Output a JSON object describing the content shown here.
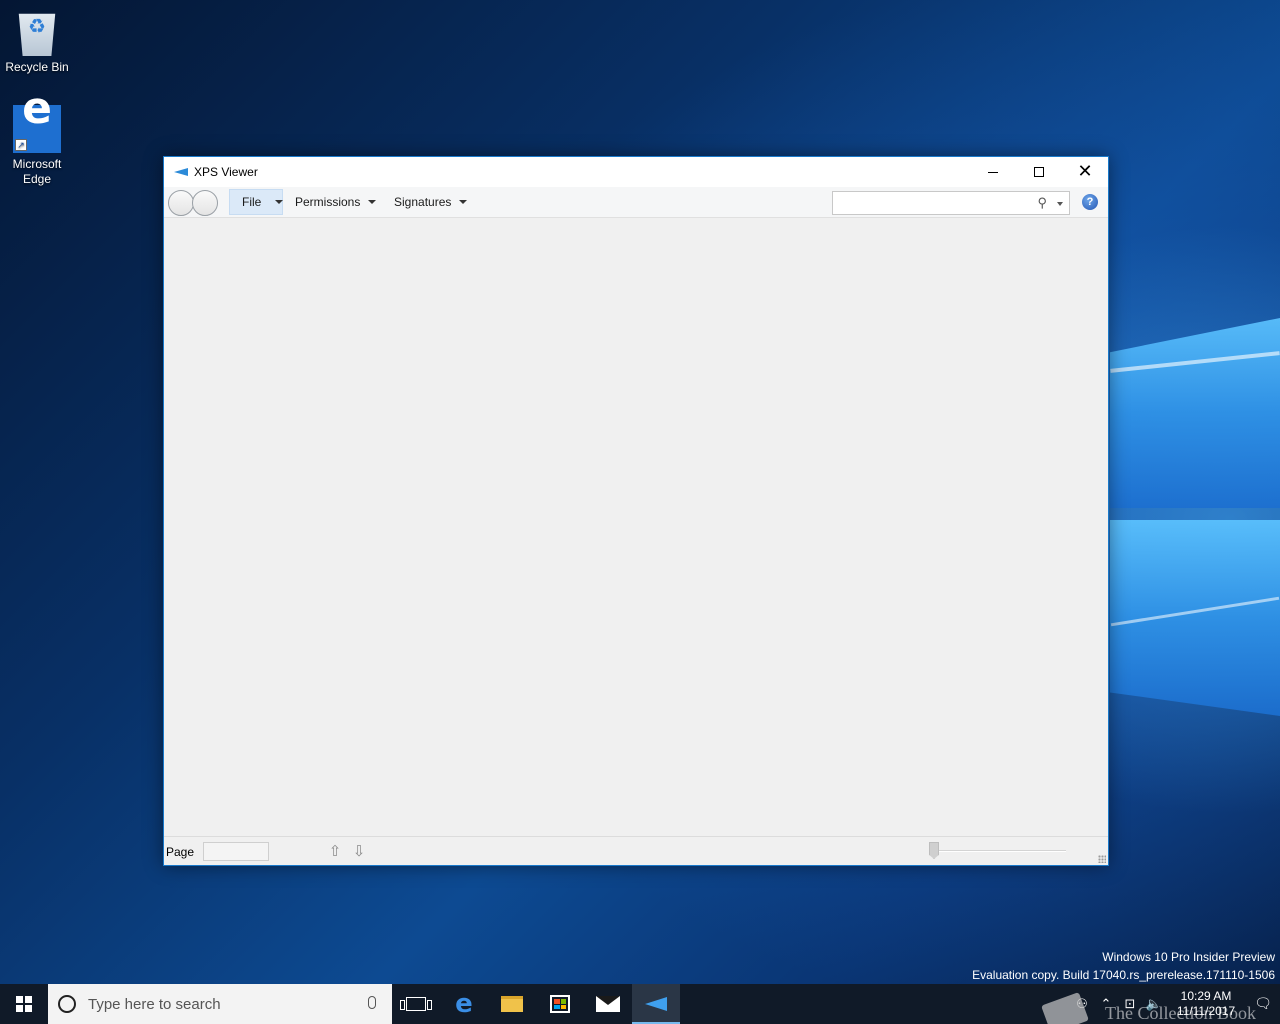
{
  "desktop": {
    "icons": [
      {
        "label": "Recycle Bin"
      },
      {
        "label": "Microsoft Edge"
      }
    ],
    "watermark": {
      "line1": "Windows 10 Pro Insider Preview",
      "line2": "Evaluation copy. Build 17040.rs_prerelease.171110-1506"
    },
    "overlay_text": "The Collection Book"
  },
  "window": {
    "title": "XPS Viewer",
    "controls": {
      "minimize": "minimize",
      "maximize": "maximize",
      "close": "close"
    },
    "toolbar": {
      "menus": [
        {
          "label": "File"
        },
        {
          "label": "Permissions"
        },
        {
          "label": "Signatures"
        }
      ],
      "search": {
        "value": "",
        "placeholder": ""
      },
      "help_label": "?"
    },
    "statusbar": {
      "page_label": "Page",
      "page_value": "",
      "up_arrow": "⇧",
      "down_arrow": "⇩"
    }
  },
  "taskbar": {
    "search_placeholder": "Type here to search",
    "apps": [
      "task-view",
      "microsoft-edge",
      "file-explorer",
      "microsoft-store",
      "mail",
      "xps-viewer"
    ],
    "active_app": "xps-viewer",
    "clock": {
      "time": "10:29 AM",
      "date": "11/11/2017"
    }
  },
  "colors": {
    "window_border": "#1979ca",
    "file_menu_highlight": "#dbe9f8",
    "taskbar": "#101a28",
    "taskbar_active_indicator": "#76b9ed"
  }
}
